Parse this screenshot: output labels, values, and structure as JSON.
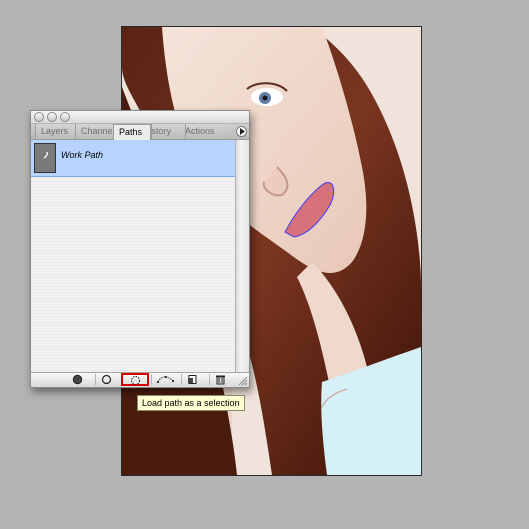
{
  "palette": {
    "tabs": [
      {
        "label": "Layers"
      },
      {
        "label": "Channels"
      },
      {
        "label": "Paths"
      },
      {
        "label": "History"
      },
      {
        "label": "Actions"
      }
    ],
    "active_tab": "Paths",
    "paths": [
      {
        "name": "Work Path",
        "selected": true
      }
    ],
    "toolbar": {
      "buttons": [
        {
          "name": "fill-path",
          "icon": "filled-circle-icon"
        },
        {
          "name": "stroke-path",
          "icon": "hollow-circle-icon"
        },
        {
          "name": "load-path-as-selection",
          "icon": "dotted-circle-icon",
          "highlighted": true
        },
        {
          "name": "make-work-path",
          "icon": "path-from-selection-icon"
        },
        {
          "name": "new-path",
          "icon": "new-page-icon"
        },
        {
          "name": "delete-path",
          "icon": "trash-icon"
        }
      ]
    }
  },
  "tooltip": {
    "text": "Load path as a selection"
  },
  "colors": {
    "selected_row": "#b6d4ff",
    "highlight": "#d40000",
    "tooltip_bg": "#fffed2",
    "background": "#b4b4b4"
  }
}
